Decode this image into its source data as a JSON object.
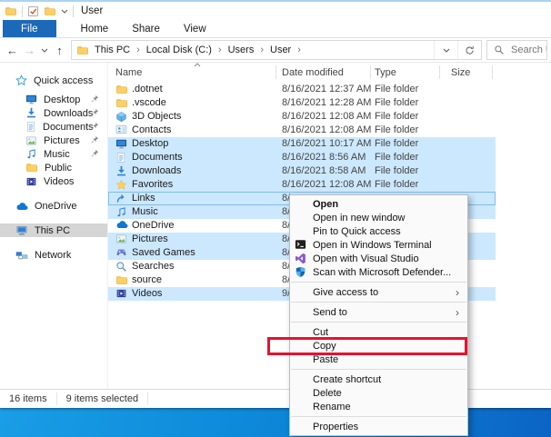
{
  "window": {
    "title": "User"
  },
  "quick_access_toolbar": {
    "icons": [
      "app-folder-icon",
      "properties-check-icon",
      "new-folder-icon",
      "customize-dropdown-icon"
    ]
  },
  "ribbon": {
    "tabs": [
      {
        "label": "File",
        "active": true
      },
      {
        "label": "Home",
        "active": false
      },
      {
        "label": "Share",
        "active": false
      },
      {
        "label": "View",
        "active": false
      }
    ]
  },
  "address_bar": {
    "breadcrumb": [
      "This PC",
      "Local Disk (C:)",
      "Users",
      "User"
    ],
    "search_placeholder": "Search Us"
  },
  "sidebar": {
    "items": [
      {
        "label": "Quick access",
        "icon": "quick-access-star",
        "level": 0,
        "gap": false,
        "pinned": false,
        "selected": false
      },
      {
        "label": "Desktop",
        "icon": "desktop",
        "level": 1,
        "gap": false,
        "pinned": true,
        "selected": false
      },
      {
        "label": "Downloads",
        "icon": "download",
        "level": 1,
        "gap": false,
        "pinned": true,
        "selected": false
      },
      {
        "label": "Documents",
        "icon": "document",
        "level": 1,
        "gap": false,
        "pinned": true,
        "selected": false
      },
      {
        "label": "Pictures",
        "icon": "picture",
        "level": 1,
        "gap": false,
        "pinned": true,
        "selected": false
      },
      {
        "label": "Music",
        "icon": "music",
        "level": 1,
        "gap": false,
        "pinned": true,
        "selected": false
      },
      {
        "label": "Public",
        "icon": "folder",
        "level": 1,
        "gap": false,
        "pinned": false,
        "selected": false
      },
      {
        "label": "Videos",
        "icon": "video",
        "level": 1,
        "gap": false,
        "pinned": false,
        "selected": false
      },
      {
        "label": "OneDrive",
        "icon": "onedrive-cloud",
        "level": 0,
        "gap": true,
        "pinned": false,
        "selected": false
      },
      {
        "label": "This PC",
        "icon": "this-pc",
        "level": 0,
        "gap": true,
        "pinned": false,
        "selected": true
      },
      {
        "label": "Network",
        "icon": "network",
        "level": 0,
        "gap": true,
        "pinned": false,
        "selected": false
      }
    ]
  },
  "file_list": {
    "columns": [
      "Name",
      "Date modified",
      "Type",
      "Size"
    ],
    "sort_column": "Name",
    "rows": [
      {
        "name": ".dotnet",
        "icon": "folder",
        "date": "8/16/2021 12:37 AM",
        "type": "File folder",
        "selected": false,
        "focused": false
      },
      {
        "name": ".vscode",
        "icon": "folder",
        "date": "8/16/2021 12:28 AM",
        "type": "File folder",
        "selected": false,
        "focused": false
      },
      {
        "name": "3D Objects",
        "icon": "cube-3d",
        "date": "8/16/2021 12:08 AM",
        "type": "File folder",
        "selected": false,
        "focused": false
      },
      {
        "name": "Contacts",
        "icon": "contacts",
        "date": "8/16/2021 12:08 AM",
        "type": "File folder",
        "selected": false,
        "focused": false
      },
      {
        "name": "Desktop",
        "icon": "desktop",
        "date": "8/16/2021 10:17 AM",
        "type": "File folder",
        "selected": true,
        "focused": false
      },
      {
        "name": "Documents",
        "icon": "document",
        "date": "8/16/2021 8:56 AM",
        "type": "File folder",
        "selected": true,
        "focused": false
      },
      {
        "name": "Downloads",
        "icon": "download",
        "date": "8/16/2021 8:58 AM",
        "type": "File folder",
        "selected": true,
        "focused": false
      },
      {
        "name": "Favorites",
        "icon": "star",
        "date": "8/16/2021 12:08 AM",
        "type": "File folder",
        "selected": true,
        "focused": false
      },
      {
        "name": "Links",
        "icon": "link",
        "date": "8/",
        "type": "",
        "selected": true,
        "focused": true
      },
      {
        "name": "Music",
        "icon": "music",
        "date": "8/",
        "type": "",
        "selected": true,
        "focused": false
      },
      {
        "name": "OneDrive",
        "icon": "onedrive-cloud",
        "date": "8/",
        "type": "",
        "selected": false,
        "focused": false
      },
      {
        "name": "Pictures",
        "icon": "picture",
        "date": "8/",
        "type": "",
        "selected": true,
        "focused": false
      },
      {
        "name": "Saved Games",
        "icon": "controller",
        "date": "8/",
        "type": "",
        "selected": true,
        "focused": false
      },
      {
        "name": "Searches",
        "icon": "magnifier",
        "date": "8/",
        "type": "",
        "selected": false,
        "focused": false
      },
      {
        "name": "source",
        "icon": "folder",
        "date": "8/",
        "type": "",
        "selected": false,
        "focused": false
      },
      {
        "name": "Videos",
        "icon": "video",
        "date": "9/",
        "type": "",
        "selected": true,
        "focused": false
      }
    ]
  },
  "context_menu": {
    "items": [
      {
        "type": "item",
        "label": "Open",
        "bold": true,
        "icon": "",
        "submenu": false,
        "annotated": false
      },
      {
        "type": "item",
        "label": "Open in new window",
        "bold": false,
        "icon": "",
        "submenu": false,
        "annotated": false
      },
      {
        "type": "item",
        "label": "Pin to Quick access",
        "bold": false,
        "icon": "",
        "submenu": false,
        "annotated": false
      },
      {
        "type": "item",
        "label": "Open in Windows Terminal",
        "bold": false,
        "icon": "terminal",
        "submenu": false,
        "annotated": false
      },
      {
        "type": "item",
        "label": "Open with Visual Studio",
        "bold": false,
        "icon": "visual-studio",
        "submenu": false,
        "annotated": false
      },
      {
        "type": "item",
        "label": "Scan with Microsoft Defender...",
        "bold": false,
        "icon": "defender",
        "submenu": false,
        "annotated": false
      },
      {
        "type": "separator"
      },
      {
        "type": "item",
        "label": "Give access to",
        "bold": false,
        "icon": "",
        "submenu": true,
        "annotated": false
      },
      {
        "type": "separator"
      },
      {
        "type": "item",
        "label": "Send to",
        "bold": false,
        "icon": "",
        "submenu": true,
        "annotated": false
      },
      {
        "type": "separator"
      },
      {
        "type": "item",
        "label": "Cut",
        "bold": false,
        "icon": "",
        "submenu": false,
        "annotated": false
      },
      {
        "type": "item",
        "label": "Copy",
        "bold": false,
        "icon": "",
        "submenu": false,
        "annotated": true
      },
      {
        "type": "item",
        "label": "Paste",
        "bold": false,
        "icon": "",
        "submenu": false,
        "annotated": false
      },
      {
        "type": "separator"
      },
      {
        "type": "item",
        "label": "Create shortcut",
        "bold": false,
        "icon": "",
        "submenu": false,
        "annotated": false
      },
      {
        "type": "item",
        "label": "Delete",
        "bold": false,
        "icon": "",
        "submenu": false,
        "annotated": false
      },
      {
        "type": "item",
        "label": "Rename",
        "bold": false,
        "icon": "",
        "submenu": false,
        "annotated": false
      },
      {
        "type": "separator"
      },
      {
        "type": "item",
        "label": "Properties",
        "bold": false,
        "icon": "",
        "submenu": false,
        "annotated": false
      }
    ]
  },
  "status_bar": {
    "item_count": "16 items",
    "selection_count": "9 items selected"
  },
  "annotation": {
    "shape": "rectangle",
    "color": "#e8112d",
    "target": "Copy"
  },
  "colors": {
    "file_tab": "#1b69b8",
    "selection": "#cce8ff",
    "desktop_top": "#21aaec",
    "desktop_bottom": "#0b64c4"
  }
}
